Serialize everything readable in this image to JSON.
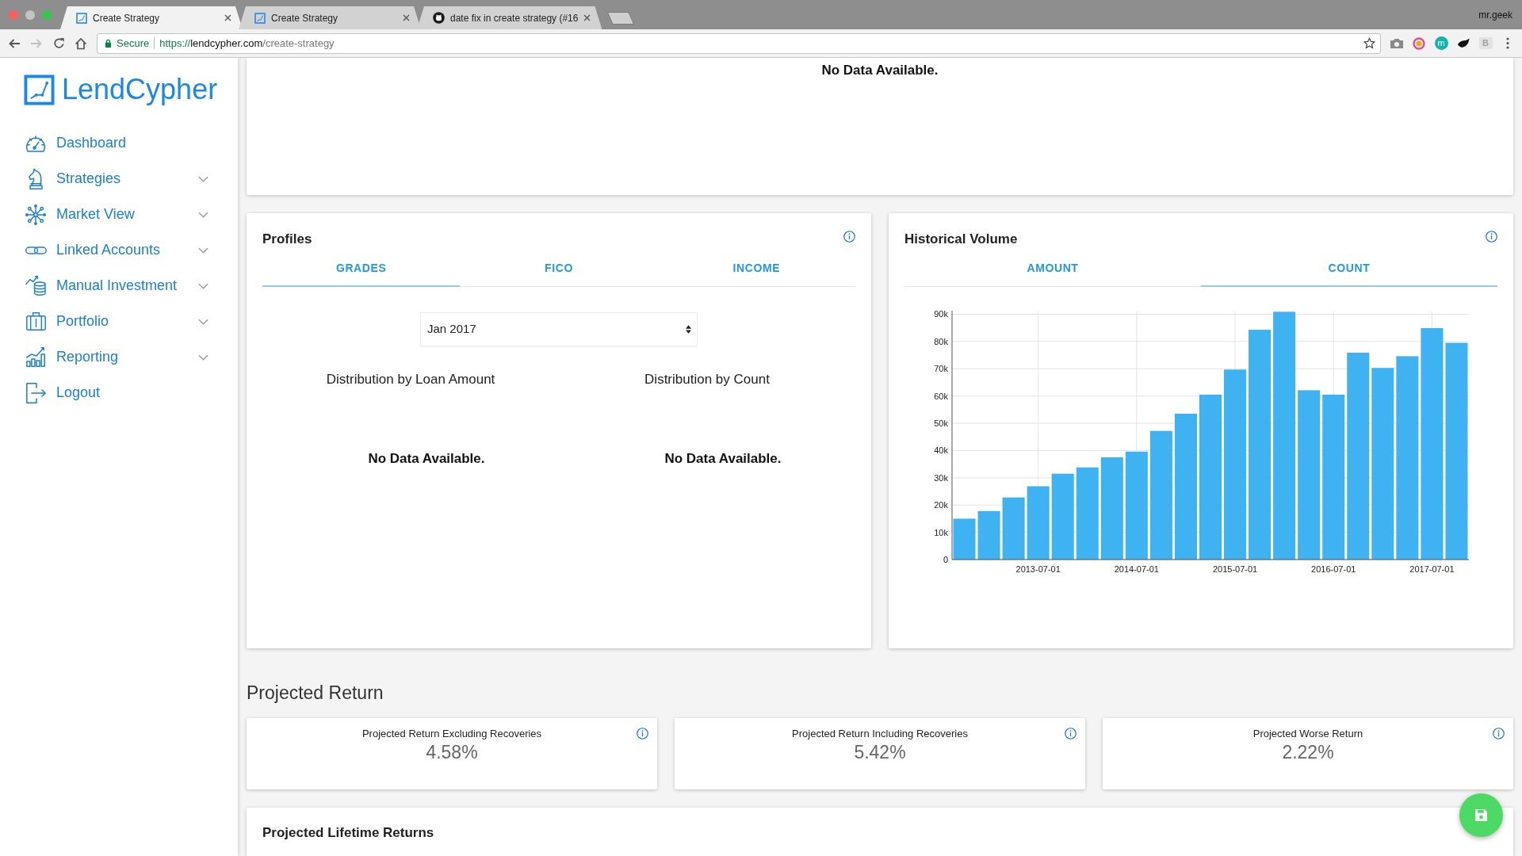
{
  "browser": {
    "tabs": [
      {
        "title": "Create Strategy",
        "kind": "app",
        "selected": true
      },
      {
        "title": "Create Strategy",
        "kind": "app",
        "selected": false
      },
      {
        "title": "date fix in create strategy (#16",
        "kind": "repo",
        "selected": false
      }
    ],
    "user": "mr.geek",
    "forward_button": {
      "disabled": true
    },
    "security_label": "Secure",
    "url": {
      "scheme": "https://",
      "host": "lendcypher.com",
      "path": "/create-strategy"
    },
    "extensions": [
      {
        "kind": "camera"
      },
      {
        "kind": "ring"
      },
      {
        "kind": "disc",
        "label": "m"
      },
      {
        "kind": "splat"
      },
      {
        "kind": "tile",
        "label": "B"
      }
    ]
  },
  "sidebar": {
    "brand": "LendCypher",
    "items": [
      {
        "label": "Dashboard",
        "has_submenu": false
      },
      {
        "label": "Strategies",
        "has_submenu": true
      },
      {
        "label": "Market View",
        "has_submenu": true
      },
      {
        "label": "Linked Accounts",
        "has_submenu": true
      },
      {
        "label": "Manual Investment",
        "has_submenu": true
      },
      {
        "label": "Portfolio",
        "has_submenu": true
      },
      {
        "label": "Reporting",
        "has_submenu": true
      },
      {
        "label": "Logout",
        "has_submenu": false
      }
    ]
  },
  "top_panel": {
    "message": "No Data Available."
  },
  "profiles": {
    "title": "Profiles",
    "tabs": [
      {
        "label": "GRADES",
        "selected": true
      },
      {
        "label": "FICO",
        "selected": false
      },
      {
        "label": "INCOME",
        "selected": false
      }
    ],
    "period_select": {
      "value": "Jan 2017"
    },
    "distributions": [
      {
        "title": "Distribution by Loan Amount",
        "message": "No Data Available."
      },
      {
        "title": "Distribution by Count",
        "message": "No Data Available."
      }
    ]
  },
  "historical_volume": {
    "title": "Historical Volume",
    "tabs": [
      {
        "label": "AMOUNT",
        "selected": false
      },
      {
        "label": "COUNT",
        "selected": true
      }
    ],
    "chart_data": [
      {
        "type": "bar",
        "categories": [
          null,
          null,
          null,
          "2013-07-01",
          null,
          null,
          null,
          "2014-07-01",
          null,
          null,
          null,
          "2015-07-01",
          null,
          null,
          null,
          "2016-07-01",
          null,
          null,
          null,
          "2017-07-01",
          null
        ],
        "values": [
          15000,
          17800,
          22800,
          26900,
          31500,
          33800,
          37500,
          39600,
          47200,
          53500,
          60500,
          69700,
          84300,
          90900,
          62100,
          60500,
          75900,
          70300,
          74600,
          84900,
          79500
        ],
        "color": "#3fb3f2",
        "ylim": [
          0,
          91000
        ],
        "yticks": [
          0,
          {
            "value": 10000,
            "label": "10k"
          },
          {
            "value": 20000,
            "label": "20k"
          },
          {
            "value": 30000,
            "label": "30k"
          },
          {
            "value": 40000,
            "label": "40k"
          },
          {
            "value": 50000,
            "label": "50k"
          },
          {
            "value": 60000,
            "label": "60k"
          },
          {
            "value": 70000,
            "label": "70k"
          },
          {
            "value": 80000,
            "label": "80k"
          },
          {
            "value": 90000,
            "label": "90k"
          }
        ],
        "grid": true
      }
    ]
  },
  "projected_return": {
    "title": "Projected Return",
    "cards": [
      {
        "label": "Projected Return Excluding Recoveries",
        "value": "4.58%"
      },
      {
        "label": "Projected Return Including Recoveries",
        "value": "5.42%"
      },
      {
        "label": "Projected Worse Return",
        "value": "2.22%"
      }
    ]
  },
  "lifetime_returns": {
    "title": "Projected Lifetime Returns"
  }
}
